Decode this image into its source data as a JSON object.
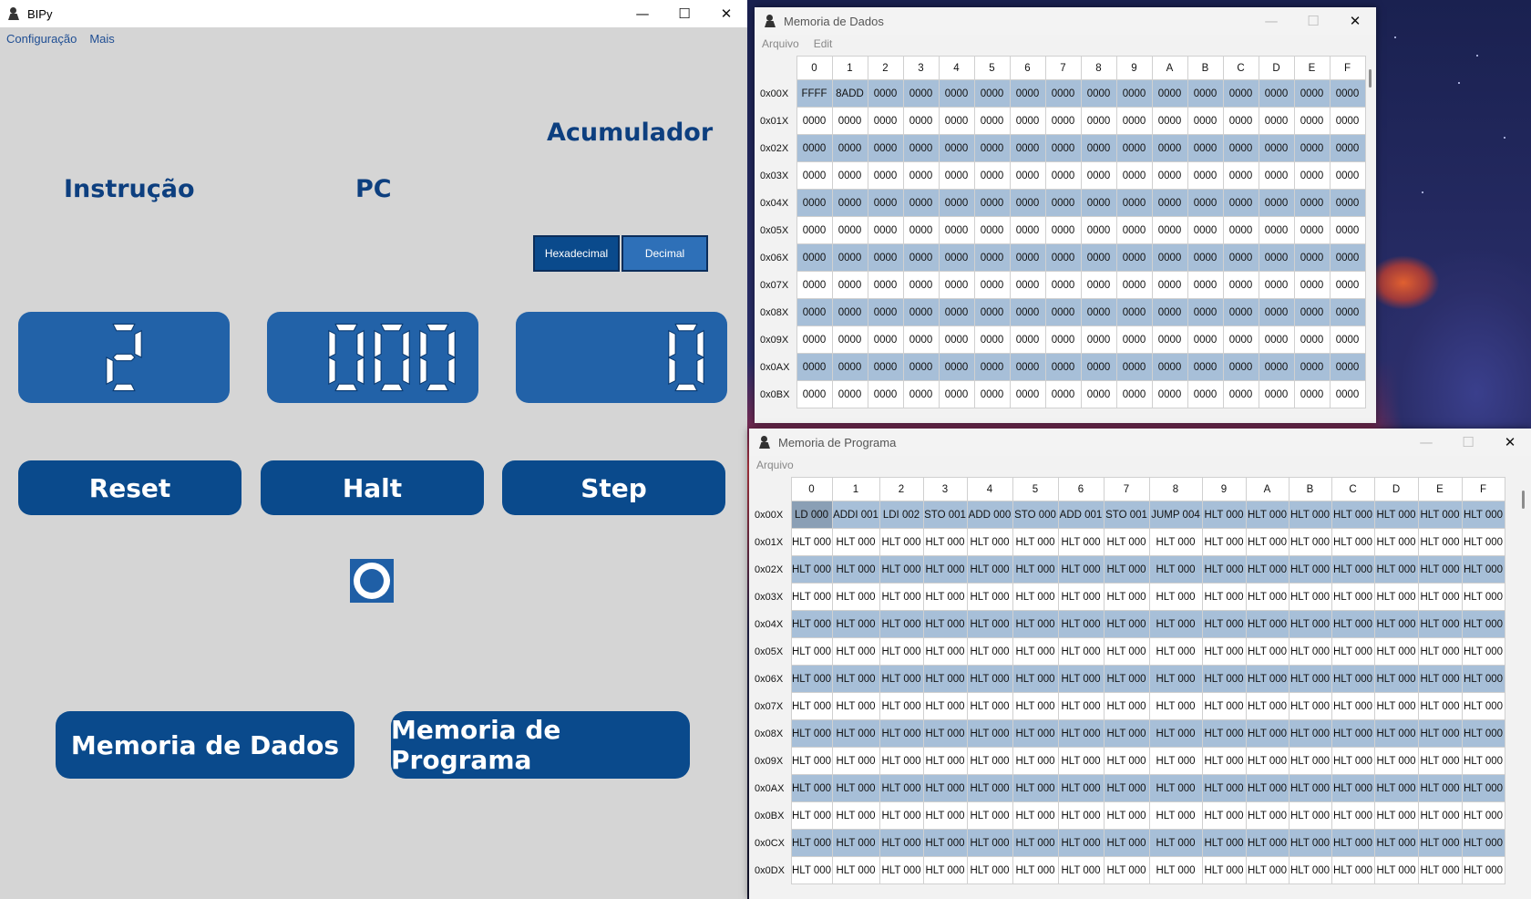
{
  "main_window": {
    "title": "BIPy",
    "menu": [
      "Configuração",
      "Mais"
    ],
    "labels": {
      "accumulator": "Acumulador",
      "instruction": "Instrução",
      "pc": "PC"
    },
    "base_toggle": {
      "hex_label": "Hexadecimal",
      "dec_label": "Decimal",
      "selected": "Hexadecimal"
    },
    "displays": {
      "instruction": "2",
      "pc": "000",
      "accumulator": "0"
    },
    "buttons": {
      "reset": "Reset",
      "halt": "Halt",
      "step": "Step",
      "data_memory": "Memoria de Dados",
      "program_memory": "Memoria de Programa"
    },
    "window_controls": {
      "minimize": "—",
      "maximize": "☐",
      "close": "✕"
    }
  },
  "data_memory_window": {
    "title": "Memoria de Dados",
    "menu": [
      "Arquivo",
      "Edit"
    ],
    "columns": [
      "0",
      "1",
      "2",
      "3",
      "4",
      "5",
      "6",
      "7",
      "8",
      "9",
      "A",
      "B",
      "C",
      "D",
      "E",
      "F"
    ],
    "rows": [
      "0x00X",
      "0x01X",
      "0x02X",
      "0x03X",
      "0x04X",
      "0x05X",
      "0x06X",
      "0x07X",
      "0x08X",
      "0x09X",
      "0x0AX",
      "0x0BX"
    ],
    "first_row_values": [
      "FFFF",
      "8ADD",
      "0000",
      "0000",
      "0000",
      "0000",
      "0000",
      "0000",
      "0000",
      "0000",
      "0000",
      "0000",
      "0000",
      "0000",
      "0000",
      "0000"
    ],
    "fill_value": "0000"
  },
  "program_memory_window": {
    "title": "Memoria de Programa",
    "menu": [
      "Arquivo"
    ],
    "columns": [
      "0",
      "1",
      "2",
      "3",
      "4",
      "5",
      "6",
      "7",
      "8",
      "9",
      "A",
      "B",
      "C",
      "D",
      "E",
      "F"
    ],
    "rows": [
      "0x00X",
      "0x01X",
      "0x02X",
      "0x03X",
      "0x04X",
      "0x05X",
      "0x06X",
      "0x07X",
      "0x08X",
      "0x09X",
      "0x0AX",
      "0x0BX",
      "0x0CX",
      "0x0DX"
    ],
    "first_row_values": [
      "LD 000",
      "ADDI 001",
      "LDI 002",
      "STO 001",
      "ADD 000",
      "STO 000",
      "ADD 001",
      "STO 001",
      "JUMP 004",
      "HLT 000",
      "HLT 000",
      "HLT 000",
      "HLT 000",
      "HLT 000",
      "HLT 000",
      "HLT 000"
    ],
    "fill_value": "HLT 000"
  },
  "colors": {
    "accent": "#0a4a8c",
    "display_bg": "#2262a8",
    "row_highlight": "#a7bfd8",
    "label": "#0d3f7f"
  }
}
